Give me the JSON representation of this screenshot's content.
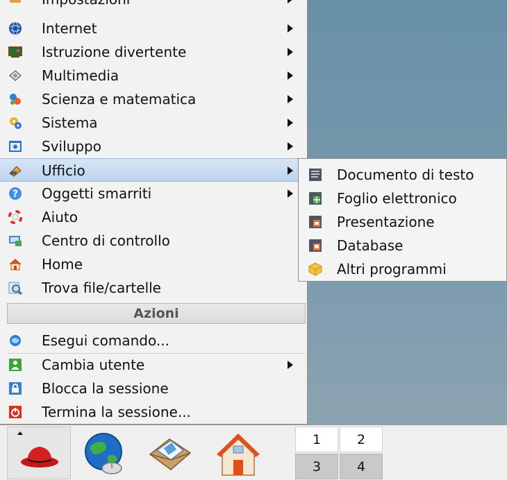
{
  "menu": {
    "items": [
      {
        "label": "Impostazioni",
        "icon": "settings-icon",
        "arrow": true
      },
      {
        "label": "Internet",
        "icon": "globe-icon",
        "arrow": true
      },
      {
        "label": "Istruzione divertente",
        "icon": "blackboard-icon",
        "arrow": true
      },
      {
        "label": "Multimedia",
        "icon": "multimedia-icon",
        "arrow": true
      },
      {
        "label": "Scienza e matematica",
        "icon": "molecule-icon",
        "arrow": true
      },
      {
        "label": "Sistema",
        "icon": "gears-icon",
        "arrow": true
      },
      {
        "label": "Sviluppo",
        "icon": "development-icon",
        "arrow": true
      },
      {
        "label": "Ufficio",
        "icon": "office-icon",
        "arrow": true,
        "highlighted": true
      },
      {
        "label": "Oggetti smarriti",
        "icon": "help-question-icon",
        "arrow": true
      },
      {
        "label": "Aiuto",
        "icon": "lifebuoy-icon",
        "arrow": false
      },
      {
        "label": "Centro di controllo",
        "icon": "control-center-icon",
        "arrow": false
      },
      {
        "label": "Home",
        "icon": "home-icon",
        "arrow": false
      },
      {
        "label": "Trova file/cartelle",
        "icon": "find-files-icon",
        "arrow": false
      }
    ],
    "actions_header": "Azioni",
    "actions": [
      {
        "label": "Esegui comando...",
        "icon": "run-command-icon",
        "arrow": false
      },
      {
        "label": "Cambia utente",
        "icon": "switch-user-icon",
        "arrow": true
      },
      {
        "label": "Blocca la sessione",
        "icon": "lock-session-icon",
        "arrow": false
      },
      {
        "label": "Termina la sessione...",
        "icon": "logout-icon",
        "arrow": false
      }
    ]
  },
  "submenu": {
    "items": [
      {
        "label": "Documento di testo",
        "icon": "text-document-icon"
      },
      {
        "label": "Foglio elettronico",
        "icon": "spreadsheet-icon"
      },
      {
        "label": "Presentazione",
        "icon": "presentation-icon"
      },
      {
        "label": "Database",
        "icon": "database-icon"
      },
      {
        "label": "Altri programmi",
        "icon": "other-programs-icon"
      }
    ]
  },
  "taskbar": {
    "launchers": [
      "redhat-menu-icon",
      "browser-globe-icon",
      "email-envelope-icon",
      "home-folder-icon"
    ],
    "pager": [
      "1",
      "2",
      "3",
      "4"
    ]
  },
  "colors": {
    "highlight": "#c8dcf2",
    "desktop": "#6f92a8",
    "menu_bg": "#f2f2f2"
  }
}
